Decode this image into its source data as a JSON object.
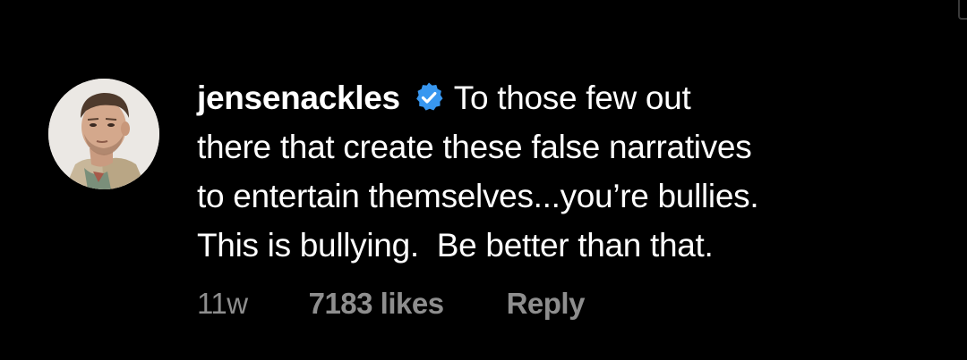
{
  "comment": {
    "avatar_icon": "profile-photo",
    "username": "jensenackles",
    "verified_icon": "verified-badge-icon",
    "verified_color": "#3897f0",
    "text_lines": [
      "To those few out",
      "there that create these false narratives",
      "to entertain themselves...you’re bullies.",
      "This is bullying.  Be better than that."
    ],
    "meta": {
      "time": "11w",
      "likes": "7183 likes",
      "reply_label": "Reply"
    }
  },
  "colors": {
    "background": "#000000",
    "text": "#ffffff",
    "meta_text": "#8e8e8e"
  }
}
